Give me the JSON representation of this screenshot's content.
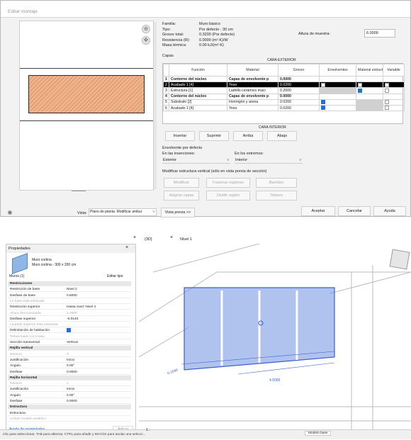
{
  "dialog": {
    "title": "Editar montaje",
    "info": [
      {
        "label": "Familia:",
        "value": "Muro básico"
      },
      {
        "label": "Tipo:",
        "value": "Por defecto - 30 cm"
      },
      {
        "label": "Grosor total:",
        "value": "0.3200 (Por defecto)"
      },
      {
        "label": "Resistencia (R):",
        "value": "0.0000 (m²·K)/W"
      },
      {
        "label": "Masa térmica:",
        "value": "0.00 kJ/(m²·K)"
      }
    ],
    "sample_height_label": "Altura de muestra:",
    "sample_height_value": "6.0000",
    "layers_label": "Capas",
    "exterior_label": "CARA EXTERIOR",
    "interior_label": "CARA INTERIOR",
    "columns": [
      "Función",
      "Material",
      "Grosor",
      "Envolventes",
      "Material estructural",
      "Variable"
    ],
    "rows": [
      {
        "n": "1",
        "funcion": "Contorno del núcleo",
        "material": "Capas de envolvente p",
        "grosor": "0.0000",
        "env": "",
        "est": "",
        "var": "",
        "kind": "core"
      },
      {
        "n": "2",
        "funcion": "Acabado 1 [4]",
        "material": "Yeso",
        "grosor": "0.0200",
        "env": "off",
        "est": "off",
        "var": "off",
        "kind": "sel"
      },
      {
        "n": "3",
        "funcion": "Estructura [1]",
        "material": "Ladrillo cerámico maci",
        "grosor": "0.2600",
        "env": "gray",
        "est": "on",
        "var": "off",
        "kind": "normal"
      },
      {
        "n": "4",
        "funcion": "Contorno del núcleo",
        "material": "Capas de envolvente p",
        "grosor": "0.0000",
        "env": "",
        "est": "",
        "var": "",
        "kind": "core"
      },
      {
        "n": "5",
        "funcion": "Substrato [2]",
        "material": "Hormigón y arena",
        "grosor": "0.0200",
        "env": "on",
        "est": "gray",
        "var": "off",
        "kind": "normal"
      },
      {
        "n": "6",
        "funcion": "Acabado 1 [4]",
        "material": "Yeso",
        "grosor": "0.0200",
        "env": "on",
        "est": "gray",
        "var": "off",
        "kind": "normal"
      }
    ],
    "buttons": {
      "insertar": "Insertar",
      "suprimir": "Suprimir",
      "arriba": "Arriba",
      "abajo": "Abajo"
    },
    "envolvente_title": "Envolvente por defecto",
    "inserciones_label": "En las inserciones:",
    "inserciones_value": "Exterior",
    "extremos_label": "En los extremos:",
    "extremos_value": "Interior",
    "modificar_title": "Modificar estructura vertical (sólo en vista previa de sección)",
    "mod_buttons": {
      "modificar": "Modificar",
      "fusionar": "Fusionar regiones",
      "barridos": "Barridos",
      "asignar": "Asignar capas",
      "dividir": "Dividir región",
      "telares": "Telares"
    },
    "vista_label": "Vista:",
    "vista_value": "Plano de planta: Modificar ambur",
    "preview_button": "Vista previa >>",
    "aceptar": "Aceptar",
    "cancelar": "Cancelar",
    "ayuda": "Ayuda"
  },
  "properties": {
    "title": "Propiedades",
    "type_name_1": "Muro cortina",
    "type_name_2": "Muro cortina - 300 x 200 cm",
    "selector": "Muros (1)",
    "edit_type": "Editar tipo",
    "rows": [
      {
        "k": "Restricciones",
        "v": "",
        "kind": "cat"
      },
      {
        "k": "Restricción de base",
        "v": "Nivel 2",
        "kind": "normal"
      },
      {
        "k": "Desfase de base",
        "v": "0.6000",
        "kind": "normal"
      },
      {
        "k": "La base está enlazada",
        "v": "",
        "kind": "dim"
      },
      {
        "k": "Restricción superior",
        "v": "Hasta nivel: Nivel 4",
        "kind": "normal"
      },
      {
        "k": "Altura desconectada",
        "v": "2.4500",
        "kind": "dim"
      },
      {
        "k": "Desfase superior",
        "v": "-0.0140",
        "kind": "normal"
      },
      {
        "k": "La parte superior está enlazada",
        "v": "",
        "kind": "dim"
      },
      {
        "k": "Delimitación de habitación",
        "v": "",
        "kind": "check"
      },
      {
        "k": "Relacionado con masa",
        "v": "",
        "kind": "dim"
      },
      {
        "k": "Sección transversal",
        "v": "Vertical",
        "kind": "normal"
      },
      {
        "k": "Rejilla vertical",
        "v": "",
        "kind": "cat"
      },
      {
        "k": "Número",
        "v": "3",
        "kind": "dim"
      },
      {
        "k": "Justificación",
        "v": "Inicio",
        "kind": "normal"
      },
      {
        "k": "Ángulo",
        "v": "0.00°",
        "kind": "normal"
      },
      {
        "k": "Desfase",
        "v": "0.0000",
        "kind": "normal"
      },
      {
        "k": "Rejilla horizontal",
        "v": "",
        "kind": "cat"
      },
      {
        "k": "Número",
        "v": "1",
        "kind": "dim"
      },
      {
        "k": "Justificación",
        "v": "Inicio",
        "kind": "normal"
      },
      {
        "k": "Ángulo",
        "v": "0.00°",
        "kind": "normal"
      },
      {
        "k": "Desfase",
        "v": "0.0000",
        "kind": "normal"
      },
      {
        "k": "Estructura",
        "v": "",
        "kind": "cat"
      },
      {
        "k": "Estructura",
        "v": "",
        "kind": "normal"
      },
      {
        "k": "Activar modelo analítico",
        "v": "",
        "kind": "dim"
      }
    ],
    "help_link": "Ayuda de propiedades",
    "apply": "Aplicar"
  },
  "views": {
    "tab1": "{3D}",
    "tab2": "Nivel 1"
  },
  "dims": {
    "d1": "0.1040",
    "d2": "4.5000"
  },
  "status": {
    "text": "Clic para seleccionar, TAB para alternar, CTRL para añadir y MAYÚS para anular una selecci...",
    "scale": "1 : ",
    "model": "Modelo base"
  },
  "colors": {
    "accent": "#1f73d6",
    "selection": "#000000",
    "wall_fill": "#f0b48a"
  }
}
